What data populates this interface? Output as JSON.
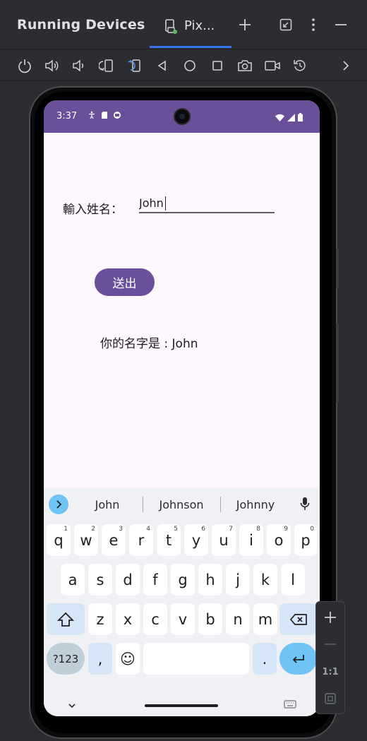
{
  "window": {
    "title": "Running Devices",
    "device_tab_label": "Pix...",
    "header_icons": [
      "add-icon",
      "restore-icon",
      "more-icon",
      "minimize-icon"
    ]
  },
  "toolbar": {
    "buttons": [
      "power-icon",
      "volume-up-icon",
      "volume-down-icon",
      "rotate-left-icon",
      "rotate-right-icon",
      "back-icon",
      "home-icon",
      "overview-icon",
      "screenshot-icon",
      "screen-record-icon",
      "reset-icon",
      "chevron-right-icon"
    ]
  },
  "status_bar": {
    "time": "3:37"
  },
  "app": {
    "name_label": "輸入姓名：",
    "name_value": "John",
    "send_label": "送出",
    "result_text": "你的名字是 : John"
  },
  "keyboard": {
    "suggestions": [
      "John",
      "Johnson",
      "Johnny"
    ],
    "row1": [
      {
        "key": "q",
        "hint": "1"
      },
      {
        "key": "w",
        "hint": "2"
      },
      {
        "key": "e",
        "hint": "3"
      },
      {
        "key": "r",
        "hint": "4"
      },
      {
        "key": "t",
        "hint": "5"
      },
      {
        "key": "y",
        "hint": "6"
      },
      {
        "key": "u",
        "hint": "7"
      },
      {
        "key": "i",
        "hint": "8"
      },
      {
        "key": "o",
        "hint": "9"
      },
      {
        "key": "p",
        "hint": "0"
      }
    ],
    "row2": [
      "a",
      "s",
      "d",
      "f",
      "g",
      "h",
      "j",
      "k",
      "l"
    ],
    "row3": [
      "z",
      "x",
      "c",
      "v",
      "b",
      "n",
      "m"
    ],
    "symbols_label": "?123",
    "comma_label": ",",
    "period_label": ".",
    "emoji_label": "☺"
  },
  "zoom_controls": {
    "actual_size_label": "1:1"
  }
}
